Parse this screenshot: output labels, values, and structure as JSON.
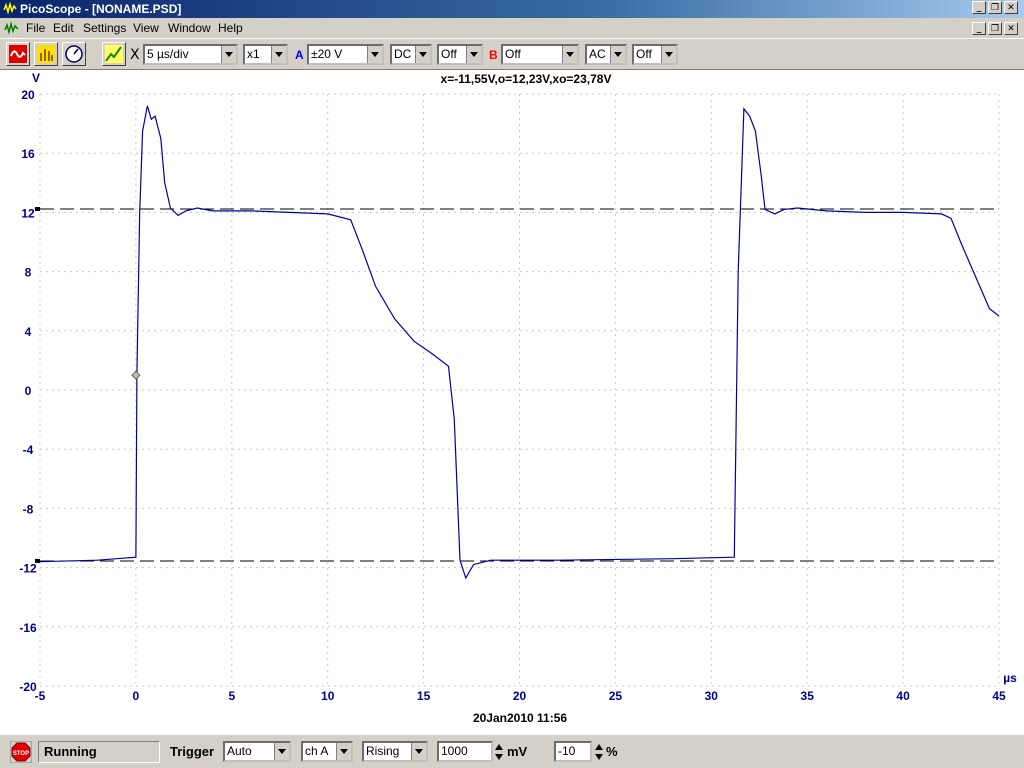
{
  "window": {
    "title": "PicoScope - [NONAME.PSD]",
    "buttons": [
      "_",
      "❐",
      "✕"
    ]
  },
  "menu": {
    "items": [
      "File",
      "Edit",
      "Settings",
      "View",
      "Window",
      "Help"
    ]
  },
  "toolbar": {
    "x_mark": "X",
    "timebase": "5 µs/div",
    "multiplier": "x1",
    "channel_a_label": "A",
    "channel_a_range": "±20 V",
    "channel_a_coupling": "DC",
    "channel_a_extra": "Off",
    "channel_b_label": "B",
    "channel_b_range": "Off",
    "channel_b_coupling": "AC",
    "channel_b_extra": "Off"
  },
  "colors": {
    "trace": "#0000a8",
    "axis_text": "#00008b",
    "channel_a": "#0000ff",
    "channel_b": "#ff0000",
    "grid": "#c8c8c8"
  },
  "icons": [
    "scope-icon",
    "spectrum-icon",
    "meter-icon",
    "trace-icon",
    "stop-icon"
  ],
  "chart_data": {
    "type": "line",
    "xlabel": "µs",
    "ylabel": "V",
    "xlim": [
      -5,
      45
    ],
    "ylim": [
      -20,
      20
    ],
    "xticks": [
      -5,
      0,
      5,
      10,
      15,
      20,
      25,
      30,
      35,
      40,
      45
    ],
    "yticks": [
      20,
      16,
      12,
      8,
      4,
      0,
      -4,
      -8,
      -12,
      -16,
      -20
    ],
    "grid": true,
    "cursor_readout": "x=-11,55V,o=12,23V,xo=23,78V",
    "timestamp": "20Jan2010  11:56",
    "cursor_levels": [
      12.23,
      -11.55
    ],
    "trigger_marker": {
      "x": 0,
      "y": 1
    },
    "series": [
      {
        "x": [
          -5,
          -2,
          0,
          0.05,
          0.2,
          0.35,
          0.6,
          0.8,
          1.0,
          1.3,
          1.5,
          1.8,
          2.2,
          2.6,
          3.2,
          4,
          6,
          8,
          10,
          11.2,
          11.8,
          12.5,
          13.5,
          14.5,
          15.5,
          16.3,
          16.6,
          16.9,
          17.2,
          17.6,
          18.5,
          22,
          28,
          31.2,
          31.4,
          31.7,
          32,
          32.3,
          32.6,
          32.8,
          33.3,
          33.8,
          34.5,
          36,
          38,
          40,
          42,
          42.5,
          43,
          43.5,
          44,
          44.5,
          45
        ],
        "y": [
          -11.6,
          -11.5,
          -11.3,
          1,
          12,
          17.5,
          19.2,
          18.3,
          18.5,
          17,
          14,
          12.3,
          11.8,
          12.1,
          12.3,
          12.1,
          12.1,
          12,
          11.9,
          11.5,
          9.5,
          7,
          4.8,
          3.3,
          2.4,
          1.6,
          -2,
          -11.5,
          -12.7,
          -11.8,
          -11.5,
          -11.5,
          -11.4,
          -11.3,
          8,
          19,
          18.5,
          17.5,
          14.5,
          12.2,
          11.9,
          12.2,
          12.3,
          12.1,
          12,
          12,
          11.9,
          11.6,
          10,
          8.5,
          7,
          5.5,
          5
        ]
      }
    ]
  },
  "status": {
    "state": "Running",
    "trigger_label": "Trigger",
    "trigger_mode": "Auto",
    "trigger_channel": "ch A",
    "trigger_edge": "Rising",
    "trigger_level": "1000",
    "level_unit": "mV",
    "pre_trigger": "-10",
    "pre_unit": "%",
    "stop_label": "STOP"
  }
}
